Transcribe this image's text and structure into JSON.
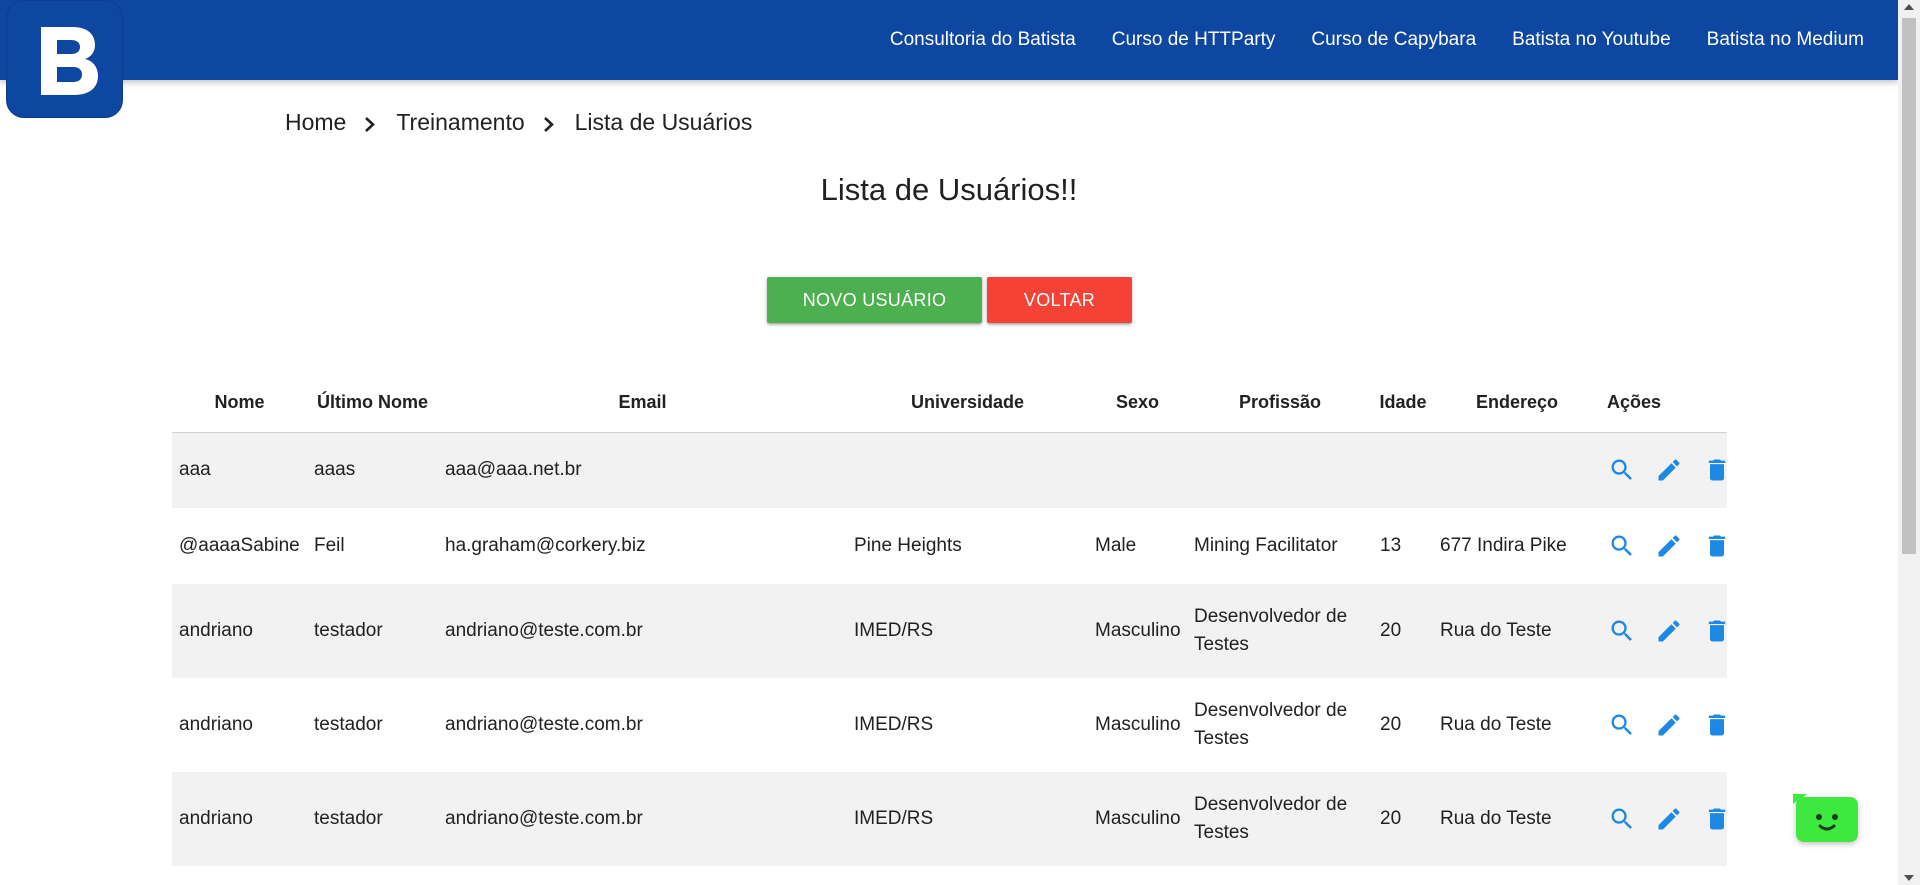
{
  "brand": {
    "logo_letter": "B",
    "logo_bg": "#0d47a1",
    "nav_bg": "#0d47a1"
  },
  "nav": {
    "links": [
      "Consultoria do Batista",
      "Curso de HTTParty",
      "Curso de Capybara",
      "Batista no Youtube",
      "Batista no Medium"
    ]
  },
  "breadcrumb": [
    "Home",
    "Treinamento",
    "Lista de Usuários"
  ],
  "page": {
    "title": "Lista de Usuários!!"
  },
  "buttons": {
    "new_user": "Novo Usuário",
    "back": "Voltar",
    "new_color": "#4caf50",
    "back_color": "#f44336"
  },
  "table": {
    "headers": [
      "Nome",
      "Último Nome",
      "Email",
      "Universidade",
      "Sexo",
      "Profissão",
      "Idade",
      "Endereço",
      "Ações"
    ],
    "rows": [
      {
        "nome": "aaa",
        "ultimo_nome": "aaas",
        "email": "aaa@aaa.net.br",
        "universidade": "",
        "sexo": "",
        "profissao": "",
        "idade": "",
        "endereco": ""
      },
      {
        "nome": "@aaaaSabine",
        "ultimo_nome": "Feil",
        "email": "ha.graham@corkery.biz",
        "universidade": "Pine Heights",
        "sexo": "Male",
        "profissao": "Mining Facilitator",
        "idade": "13",
        "endereco": "677 Indira Pike"
      },
      {
        "nome": "andriano",
        "ultimo_nome": "testador",
        "email": "andriano@teste.com.br",
        "universidade": "IMED/RS",
        "sexo": "Masculino",
        "profissao": "Desenvolvedor de Testes",
        "idade": "20",
        "endereco": "Rua do Teste"
      },
      {
        "nome": "andriano",
        "ultimo_nome": "testador",
        "email": "andriano@teste.com.br",
        "universidade": "IMED/RS",
        "sexo": "Masculino",
        "profissao": "Desenvolvedor de Testes",
        "idade": "20",
        "endereco": "Rua do Teste"
      },
      {
        "nome": "andriano",
        "ultimo_nome": "testador",
        "email": "andriano@teste.com.br",
        "universidade": "IMED/RS",
        "sexo": "Masculino",
        "profissao": "Desenvolvedor de Testes",
        "idade": "20",
        "endereco": "Rua do Teste"
      }
    ],
    "action_icons": [
      "search-icon",
      "edit-pencil-icon",
      "delete-trash-icon"
    ],
    "action_color": "#1e88e5"
  },
  "chat_widget": {
    "icon": "chat-bot-icon",
    "color": "#3ee83e"
  }
}
